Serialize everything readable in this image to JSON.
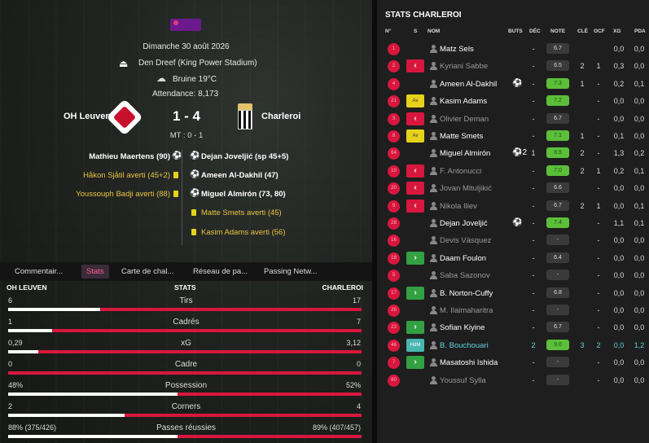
{
  "match": {
    "date": "Dimanche 30 août 2026",
    "stadium": "Den Dreef (King Power Stadium)",
    "weather": "Bruine 19°C",
    "attendance": "Attendance: 8,173",
    "home": "OH Leuven",
    "away": "Charleroi",
    "score": "1 - 4",
    "halftime": "MT : 0 - 1"
  },
  "events": {
    "home": [
      {
        "text": "Mathieu Maertens (90)",
        "type": "goal"
      },
      {
        "text": "Håkon Sjåtil averti (45+2)",
        "type": "card"
      },
      {
        "text": "Youssouph Badji averti (88)",
        "type": "card"
      }
    ],
    "away": [
      {
        "text": "Dejan Joveljić (sp 45+5)",
        "type": "goal"
      },
      {
        "text": "Ameen Al-Dakhil (47)",
        "type": "goal"
      },
      {
        "text": "Miguel Almirón (73, 80)",
        "type": "goal"
      },
      {
        "text": "Matte Smets averti (45)",
        "type": "card"
      },
      {
        "text": "Kasim Adams averti (56)",
        "type": "card"
      }
    ]
  },
  "tabs": [
    "Commentair...",
    "Stats",
    "Carte de chal...",
    "Réseau de pa...",
    "Passing Netw..."
  ],
  "stats": {
    "home_label": "OH LEUVEN",
    "title": "STATS",
    "away_label": "CHARLEROI",
    "rows": [
      {
        "label": "Tirs",
        "home": "6",
        "away": "17",
        "home_share": 0.26
      },
      {
        "label": "Cadrés",
        "home": "1",
        "away": "7",
        "home_share": 0.125
      },
      {
        "label": "xG",
        "home": "0,29",
        "away": "3,12",
        "home_share": 0.085
      },
      {
        "label": "Cadre",
        "home": "0",
        "away": "0",
        "home_share": 0.0
      },
      {
        "label": "Possession",
        "home": "48%",
        "away": "52%",
        "home_share": 0.48
      },
      {
        "label": "Corners",
        "home": "2",
        "away": "4",
        "home_share": 0.33
      },
      {
        "label": "Passes réussies",
        "home": "88% (375/426)",
        "away": "89% (407/457)",
        "home_share": 0.48
      }
    ]
  },
  "right": {
    "title": "STATS CHARLEROI",
    "columns": [
      "N°",
      "S",
      "NOM",
      "BUTS",
      "DÉC",
      "NOTE",
      "CLÉ",
      "OCF",
      "XG",
      "PDA"
    ],
    "players": [
      {
        "no": "1",
        "s": "",
        "name": "Matz Sels",
        "buts": "",
        "dec": "-",
        "note": "6.7",
        "cle": "",
        "ocf": "",
        "xg": "0,0",
        "pda": "0,0",
        "on": true,
        "rc": "n"
      },
      {
        "no": "2",
        "s": "out",
        "name": "Kyriani Sabbe",
        "buts": "",
        "dec": "-",
        "note": "6.5",
        "cle": "2",
        "ocf": "1",
        "xg": "0,3",
        "pda": "0,0",
        "on": false,
        "rc": "n"
      },
      {
        "no": "4",
        "s": "",
        "name": "Ameen Al-Dakhil",
        "ball": "⚽",
        "buts": "",
        "dec": "-",
        "note": "7.3",
        "cle": "1",
        "ocf": "-",
        "xg": "0,2",
        "pda": "0,1",
        "on": true,
        "rc": "g"
      },
      {
        "no": "21",
        "s": "Av",
        "name": "Kasim Adams",
        "buts": "",
        "dec": "-",
        "note": "7.2",
        "cle": "",
        "ocf": "-",
        "xg": "0,0",
        "pda": "0,0",
        "on": true,
        "rc": "g"
      },
      {
        "no": "3",
        "s": "out",
        "name": "Olivier Deman",
        "buts": "",
        "dec": "-",
        "note": "6.7",
        "cle": "",
        "ocf": "-",
        "xg": "0,0",
        "pda": "0,0",
        "on": false,
        "rc": "n"
      },
      {
        "no": "8",
        "s": "Av",
        "name": "Matte Smets",
        "buts": "",
        "dec": "-",
        "note": "7.1",
        "cle": "1",
        "ocf": "-",
        "xg": "0,1",
        "pda": "0,0",
        "on": true,
        "rc": "g"
      },
      {
        "no": "64",
        "s": "",
        "name": "Miguel Almirón",
        "ball": "⚽2",
        "buts": "",
        "dec": "1",
        "note": "8.5",
        "cle": "2",
        "ocf": "-",
        "xg": "1,3",
        "pda": "0,2",
        "on": true,
        "rc": "g"
      },
      {
        "no": "10",
        "s": "out",
        "name": "F. Antonucci",
        "buts": "",
        "dec": "-",
        "note": "7.0",
        "cle": "2",
        "ocf": "1",
        "xg": "0,2",
        "pda": "0,1",
        "on": false,
        "rc": "g"
      },
      {
        "no": "20",
        "s": "out",
        "name": "Jovan Mitulјikić",
        "buts": "",
        "dec": "-",
        "note": "6.6",
        "cle": "",
        "ocf": "-",
        "xg": "0,0",
        "pda": "0,0",
        "on": false,
        "rc": "n"
      },
      {
        "no": "9",
        "s": "out",
        "name": "Nikola Iliev",
        "buts": "",
        "dec": "-",
        "note": "6.7",
        "cle": "2",
        "ocf": "1",
        "xg": "0,0",
        "pda": "0,1",
        "on": false,
        "rc": "n"
      },
      {
        "no": "28",
        "s": "",
        "name": "Dejan Joveljić",
        "ball": "⚽",
        "buts": "",
        "dec": "-",
        "note": "7.4",
        "cle": "",
        "ocf": "-",
        "xg": "1,1",
        "pda": "0,1",
        "on": true,
        "rc": "g"
      },
      {
        "no": "16",
        "s": "",
        "name": "Devis Vásquez",
        "buts": "",
        "dec": "-",
        "note": "-",
        "cle": "",
        "ocf": "-",
        "xg": "0,0",
        "pda": "0,0",
        "on": false,
        "rc": "d"
      },
      {
        "no": "18",
        "s": "in",
        "name": "Daam Foulon",
        "buts": "",
        "dec": "-",
        "note": "6.4",
        "cle": "",
        "ocf": "-",
        "xg": "0,0",
        "pda": "0,0",
        "on": true,
        "rc": "n"
      },
      {
        "no": "5",
        "s": "",
        "name": "Saba Sazonov",
        "buts": "",
        "dec": "-",
        "note": "-",
        "cle": "",
        "ocf": "-",
        "xg": "0,0",
        "pda": "0,0",
        "on": false,
        "rc": "d"
      },
      {
        "no": "17",
        "s": "in",
        "name": "B. Norton-Cuffy",
        "buts": "",
        "dec": "-",
        "note": "6.8",
        "cle": "",
        "ocf": "-",
        "xg": "0,0",
        "pda": "0,0",
        "on": true,
        "rc": "n"
      },
      {
        "no": "26",
        "s": "",
        "name": "M. Ilaimaharitra",
        "buts": "",
        "dec": "-",
        "note": "-",
        "cle": "",
        "ocf": "-",
        "xg": "0,0",
        "pda": "0,0",
        "on": false,
        "rc": "d"
      },
      {
        "no": "23",
        "s": "in",
        "name": "Sofian Kiyine",
        "buts": "",
        "dec": "-",
        "note": "6.7",
        "cle": "",
        "ocf": "-",
        "xg": "0,0",
        "pda": "0,0",
        "on": true,
        "rc": "n"
      },
      {
        "no": "46",
        "s": "HdM",
        "name": "B. Bouchouari",
        "buts": "",
        "dec": "2",
        "note": "9.0",
        "cle": "3",
        "ocf": "2",
        "xg": "0,0",
        "pda": "1,2",
        "on": true,
        "rc": "g",
        "cyan": true
      },
      {
        "no": "7",
        "s": "in",
        "name": "Masatoshi Ishida",
        "buts": "",
        "dec": "-",
        "note": "-",
        "cle": "",
        "ocf": "-",
        "xg": "0,0",
        "pda": "0,0",
        "on": true,
        "rc": "d"
      },
      {
        "no": "80",
        "s": "",
        "name": "Youssuf Sylla",
        "buts": "",
        "dec": "-",
        "note": "-",
        "cle": "",
        "ocf": "-",
        "xg": "0,0",
        "pda": "0,0",
        "on": false,
        "rc": "d"
      }
    ]
  }
}
